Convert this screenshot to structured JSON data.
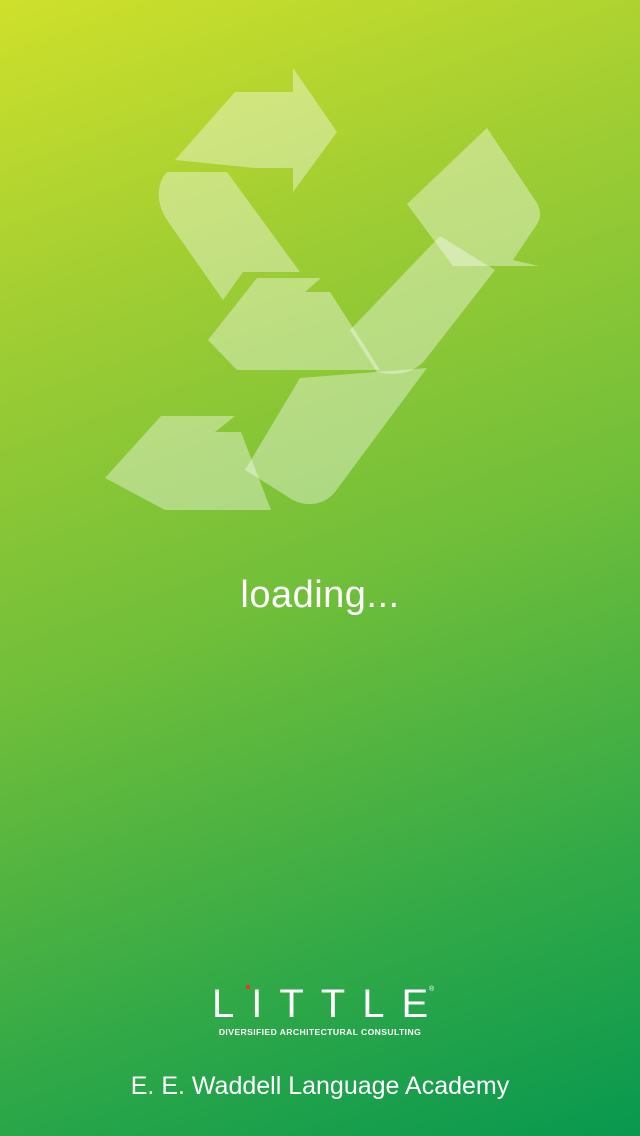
{
  "splash": {
    "loading_text": "loading...",
    "logo_icon": "recycle-arrows-icon"
  },
  "branding": {
    "wordmark": "LITTLE",
    "registered_mark": "®",
    "tagline": "DIVERSIFIED ARCHITECTURAL CONSULTING",
    "accent_color": "#e23a2a"
  },
  "footer": {
    "academy_name": "E. E. Waddell Language Academy"
  },
  "colors": {
    "gradient_top": "#cfe02b",
    "gradient_bottom": "#08984f",
    "text": "#ffffff"
  }
}
